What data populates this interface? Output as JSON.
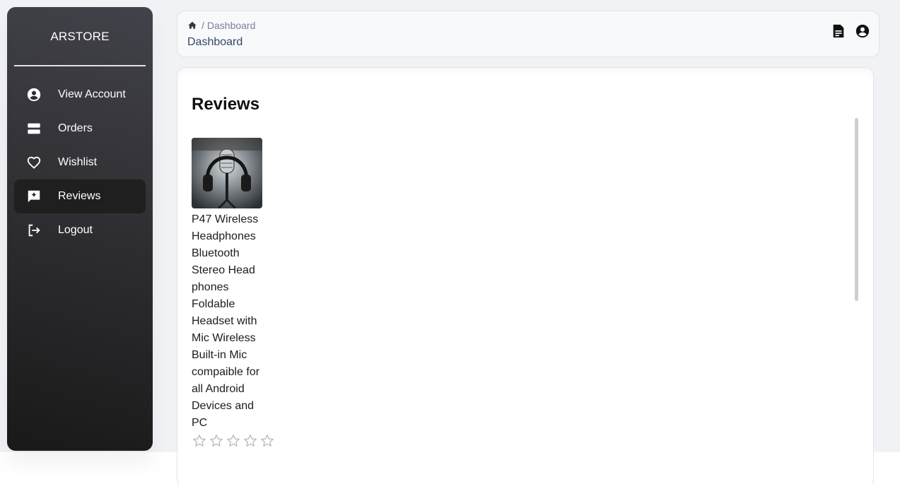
{
  "sidebar": {
    "brand": "ARSTORE",
    "items": [
      {
        "label": "View Account",
        "icon": "account-circle-icon",
        "active": false
      },
      {
        "label": "Orders",
        "icon": "storage-icon",
        "active": false
      },
      {
        "label": "Wishlist",
        "icon": "heart-outline-icon",
        "active": false
      },
      {
        "label": "Reviews",
        "icon": "rate-review-icon",
        "active": true
      },
      {
        "label": "Logout",
        "icon": "logout-icon",
        "active": false
      }
    ]
  },
  "header": {
    "breadcrumb": {
      "separator": "/",
      "current": "Dashboard"
    },
    "title": "Dashboard",
    "icons": [
      "document-icon",
      "account-circle-icon"
    ]
  },
  "main": {
    "title": "Reviews",
    "reviews": [
      {
        "product_name": "P47 Wireless Headphones Bluetooth Stereo Head phones Foldable Headset with Mic Wireless Built-in Mic compaible for all Android Devices and PC",
        "rating": 0,
        "max_rating": 5
      }
    ]
  },
  "colors": {
    "sidebar_gradient_top": "#42424a",
    "sidebar_gradient_bottom": "#191919",
    "page_bg": "#f0f2f5",
    "star_outline": "#b8b8b8"
  }
}
